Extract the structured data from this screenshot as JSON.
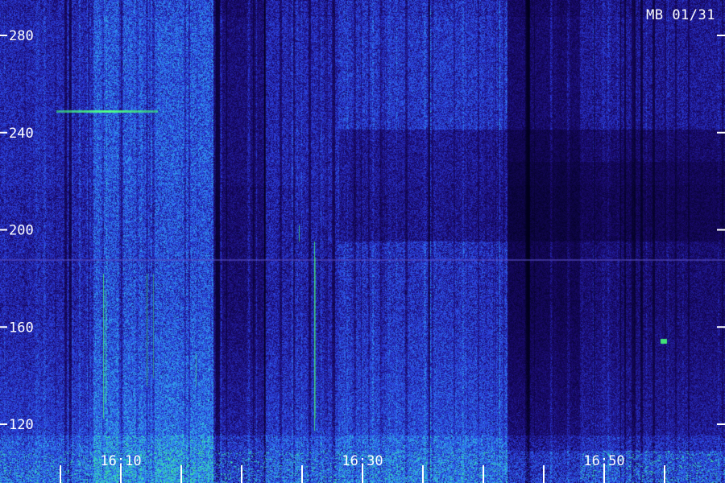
{
  "station_label": "MB 01/31",
  "chart_data": {
    "type": "heatmap",
    "title": "MB 01/31",
    "xlabel": "",
    "ylabel": "",
    "y_ticks": [
      280,
      240,
      200,
      160,
      120
    ],
    "ylim": [
      105,
      293
    ],
    "x_ticks": [
      "16:10",
      "16:30",
      "16:50"
    ],
    "grid": false,
    "colormap": [
      "#000018",
      "#1a0a6e",
      "#2a3ad8",
      "#2f7cf0",
      "#33c8e0",
      "#3cf07a"
    ],
    "notable_features": [
      {
        "label": "carrier",
        "y": 249
      },
      {
        "label": "band-edge",
        "y": 188
      }
    ]
  },
  "colors": {
    "background": "#05022a",
    "text": "#ffffff"
  }
}
